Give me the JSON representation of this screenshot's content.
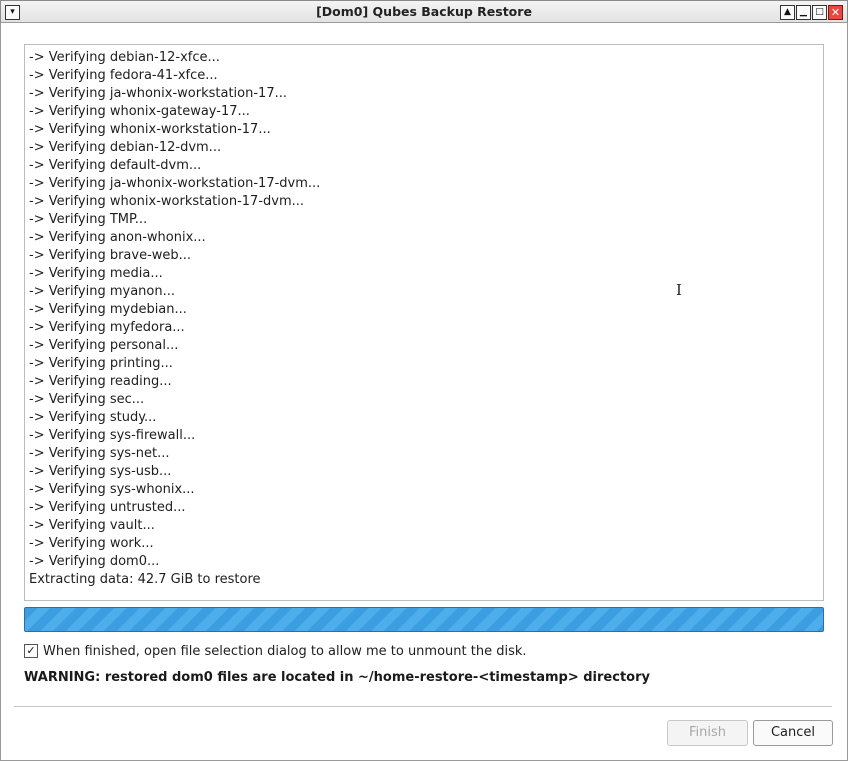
{
  "window": {
    "title": "[Dom0] Qubes Backup Restore",
    "menu_icon": "▾",
    "btn_shade": "▲",
    "btn_minimize": "▁",
    "btn_maximize": "□",
    "btn_close": "✕"
  },
  "log": {
    "lines": [
      "-> Verifying debian-12-xfce...",
      "-> Verifying fedora-41-xfce...",
      "-> Verifying ja-whonix-workstation-17...",
      "-> Verifying whonix-gateway-17...",
      "-> Verifying whonix-workstation-17...",
      "-> Verifying debian-12-dvm...",
      "-> Verifying default-dvm...",
      "-> Verifying ja-whonix-workstation-17-dvm...",
      "-> Verifying whonix-workstation-17-dvm...",
      "-> Verifying TMP...",
      "-> Verifying anon-whonix...",
      "-> Verifying brave-web...",
      "-> Verifying media...",
      "-> Verifying myanon...",
      "-> Verifying mydebian...",
      "-> Verifying myfedora...",
      "-> Verifying personal...",
      "-> Verifying printing...",
      "-> Verifying reading...",
      "-> Verifying sec...",
      "-> Verifying study...",
      "-> Verifying sys-firewall...",
      "-> Verifying sys-net...",
      "-> Verifying sys-usb...",
      "-> Verifying sys-whonix...",
      "-> Verifying untrusted...",
      "-> Verifying vault...",
      "-> Verifying work...",
      "-> Verifying dom0...",
      "Extracting data: 42.7 GiB to restore"
    ]
  },
  "progress": {
    "state": "indeterminate",
    "accent": "#3a9ee0"
  },
  "options": {
    "unmount_checkbox_checked": true,
    "unmount_checkbox_mark": "✓",
    "unmount_label": "When finished, open file selection dialog to allow me to unmount the disk."
  },
  "warning_text": "WARNING: restored dom0 files are located in ~/home-restore-<timestamp> directory",
  "buttons": {
    "finish_label": "Finish",
    "cancel_label": "Cancel"
  },
  "cursor_glyph": "I"
}
